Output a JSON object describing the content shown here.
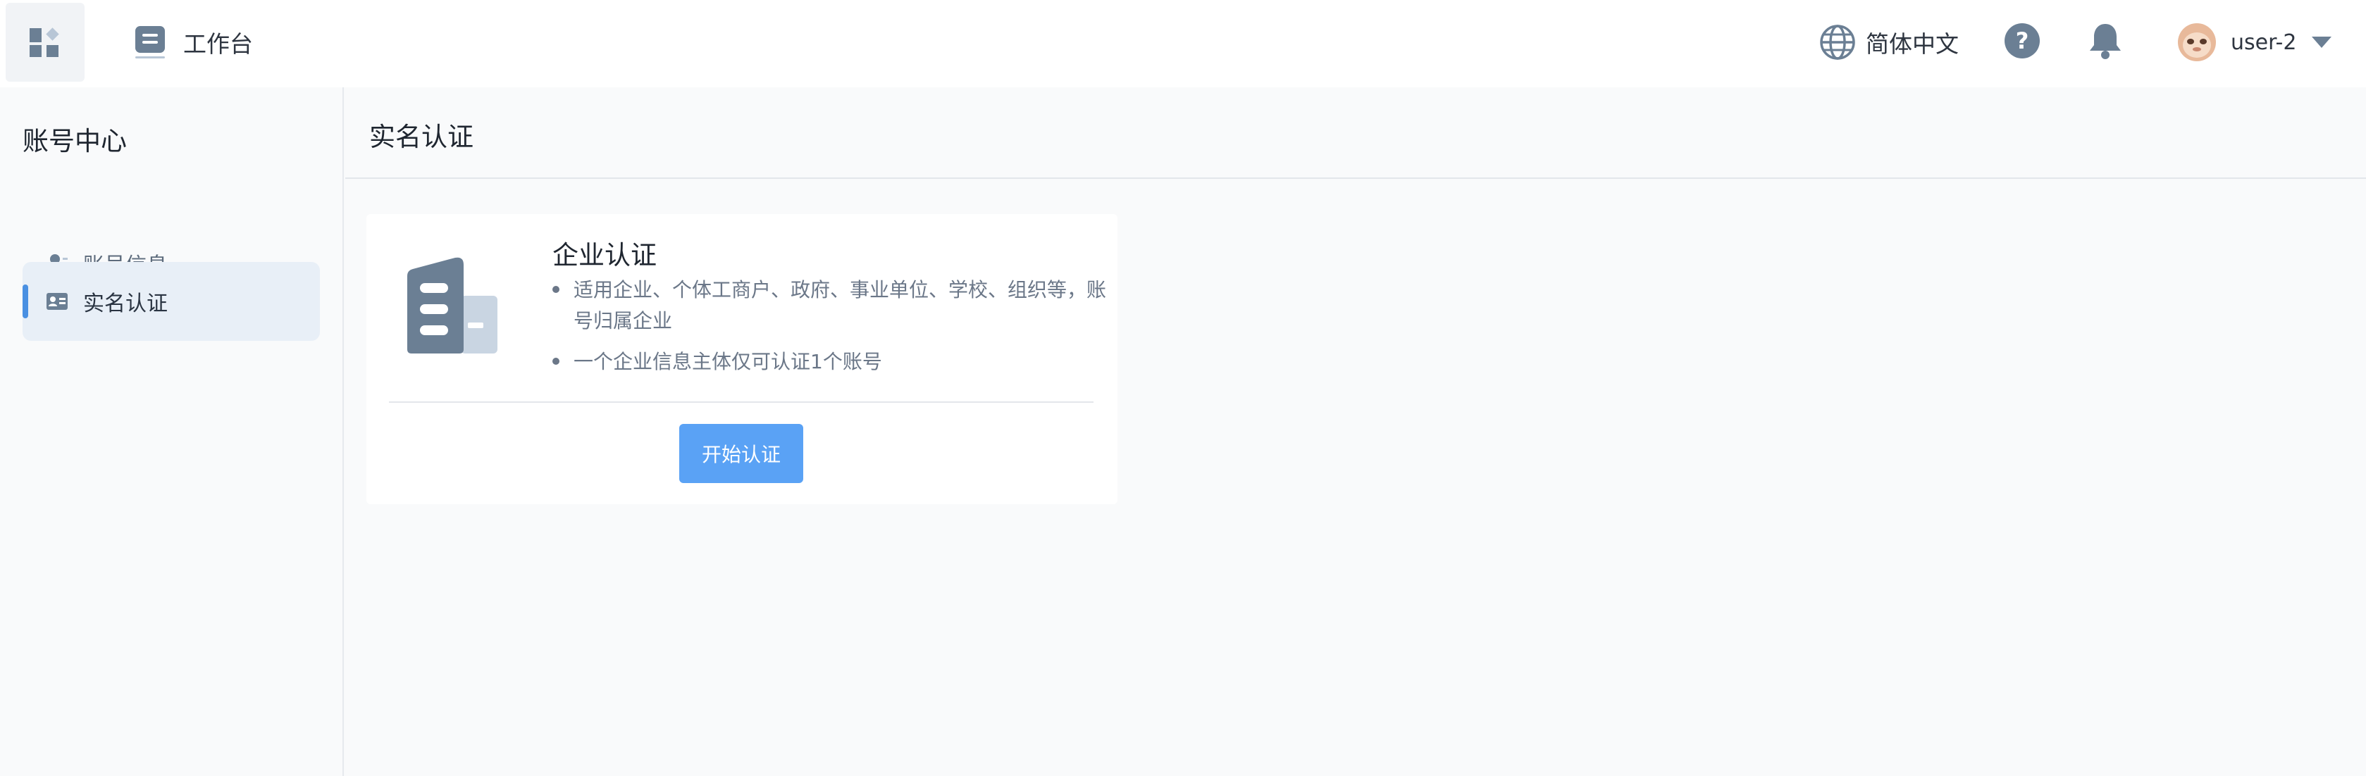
{
  "header": {
    "workbench_label": "工作台",
    "language_label": "简体中文",
    "user_name": "user-2"
  },
  "sidebar": {
    "title": "账号中心",
    "items": [
      {
        "label": "账号信息",
        "icon": "user-icon",
        "active": false
      },
      {
        "label": "实名认证",
        "icon": "id-card-icon",
        "active": true
      }
    ]
  },
  "main": {
    "page_title": "实名认证",
    "card": {
      "title": "企业认证",
      "bullets": [
        "适用企业、个体工商户、政府、事业单位、学校、组织等，账号归属企业",
        "一个企业信息主体仅可认证1个账号"
      ],
      "button_label": "开始认证"
    }
  },
  "colors": {
    "accent": "#4a90e2",
    "button": "#5aa2f5",
    "icon": "#6b7f94"
  }
}
